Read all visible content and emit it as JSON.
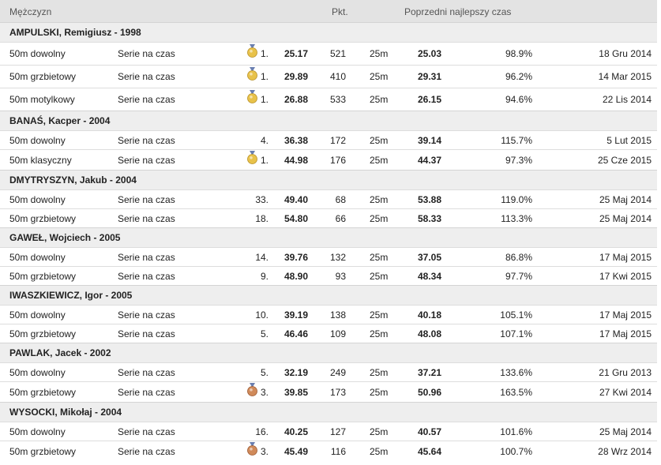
{
  "header": {
    "category": "Mężczyzn",
    "points": "Pkt.",
    "previous_best": "Poprzedni najlepszy czas"
  },
  "colors": {
    "gold_medal": "#e8c24a",
    "bronze_medal": "#d08a5a",
    "header_bg": "#e3e3e3",
    "athlete_bg": "#eeeeee"
  },
  "athletes": [
    {
      "name": "AMPULSKI, Remigiusz - 1998",
      "results": [
        {
          "event": "50m dowolny",
          "type": "Serie na czas",
          "place": "1.",
          "medal": "gold",
          "time": "25.17",
          "points": "521",
          "pool": "25m",
          "prev_time": "25.03",
          "percent": "98.9%",
          "date": "18 Gru 2014"
        },
        {
          "event": "50m grzbietowy",
          "type": "Serie na czas",
          "place": "1.",
          "medal": "gold",
          "time": "29.89",
          "points": "410",
          "pool": "25m",
          "prev_time": "29.31",
          "percent": "96.2%",
          "date": "14 Mar 2015"
        },
        {
          "event": "50m motylkowy",
          "type": "Serie na czas",
          "place": "1.",
          "medal": "gold",
          "time": "26.88",
          "points": "533",
          "pool": "25m",
          "prev_time": "26.15",
          "percent": "94.6%",
          "date": "22 Lis 2014"
        }
      ]
    },
    {
      "name": "BANAŚ, Kacper - 2004",
      "results": [
        {
          "event": "50m dowolny",
          "type": "Serie na czas",
          "place": "4.",
          "medal": "",
          "time": "36.38",
          "points": "172",
          "pool": "25m",
          "prev_time": "39.14",
          "percent": "115.7%",
          "date": "5 Lut 2015"
        },
        {
          "event": "50m klasyczny",
          "type": "Serie na czas",
          "place": "1.",
          "medal": "gold",
          "time": "44.98",
          "points": "176",
          "pool": "25m",
          "prev_time": "44.37",
          "percent": "97.3%",
          "date": "25 Cze 2015"
        }
      ]
    },
    {
      "name": "DMYTRYSZYN, Jakub - 2004",
      "results": [
        {
          "event": "50m dowolny",
          "type": "Serie na czas",
          "place": "33.",
          "medal": "",
          "time": "49.40",
          "points": "68",
          "pool": "25m",
          "prev_time": "53.88",
          "percent": "119.0%",
          "date": "25 Maj 2014"
        },
        {
          "event": "50m grzbietowy",
          "type": "Serie na czas",
          "place": "18.",
          "medal": "",
          "time": "54.80",
          "points": "66",
          "pool": "25m",
          "prev_time": "58.33",
          "percent": "113.3%",
          "date": "25 Maj 2014"
        }
      ]
    },
    {
      "name": "GAWEŁ, Wojciech - 2005",
      "results": [
        {
          "event": "50m dowolny",
          "type": "Serie na czas",
          "place": "14.",
          "medal": "",
          "time": "39.76",
          "points": "132",
          "pool": "25m",
          "prev_time": "37.05",
          "percent": "86.8%",
          "date": "17 Maj 2015"
        },
        {
          "event": "50m grzbietowy",
          "type": "Serie na czas",
          "place": "9.",
          "medal": "",
          "time": "48.90",
          "points": "93",
          "pool": "25m",
          "prev_time": "48.34",
          "percent": "97.7%",
          "date": "17 Kwi 2015"
        }
      ]
    },
    {
      "name": "IWASZKIEWICZ, Igor - 2005",
      "results": [
        {
          "event": "50m dowolny",
          "type": "Serie na czas",
          "place": "10.",
          "medal": "",
          "time": "39.19",
          "points": "138",
          "pool": "25m",
          "prev_time": "40.18",
          "percent": "105.1%",
          "date": "17 Maj 2015"
        },
        {
          "event": "50m grzbietowy",
          "type": "Serie na czas",
          "place": "5.",
          "medal": "",
          "time": "46.46",
          "points": "109",
          "pool": "25m",
          "prev_time": "48.08",
          "percent": "107.1%",
          "date": "17 Maj 2015"
        }
      ]
    },
    {
      "name": "PAWLAK, Jacek - 2002",
      "results": [
        {
          "event": "50m dowolny",
          "type": "Serie na czas",
          "place": "5.",
          "medal": "",
          "time": "32.19",
          "points": "249",
          "pool": "25m",
          "prev_time": "37.21",
          "percent": "133.6%",
          "date": "21 Gru 2013"
        },
        {
          "event": "50m grzbietowy",
          "type": "Serie na czas",
          "place": "3.",
          "medal": "bronze",
          "time": "39.85",
          "points": "173",
          "pool": "25m",
          "prev_time": "50.96",
          "percent": "163.5%",
          "date": "27 Kwi 2014"
        }
      ]
    },
    {
      "name": "WYSOCKI, Mikołaj - 2004",
      "results": [
        {
          "event": "50m dowolny",
          "type": "Serie na czas",
          "place": "16.",
          "medal": "",
          "time": "40.25",
          "points": "127",
          "pool": "25m",
          "prev_time": "40.57",
          "percent": "101.6%",
          "date": "25 Maj 2014"
        },
        {
          "event": "50m grzbietowy",
          "type": "Serie na czas",
          "place": "3.",
          "medal": "bronze",
          "time": "45.49",
          "points": "116",
          "pool": "25m",
          "prev_time": "45.64",
          "percent": "100.7%",
          "date": "28 Wrz 2014"
        }
      ]
    }
  ]
}
